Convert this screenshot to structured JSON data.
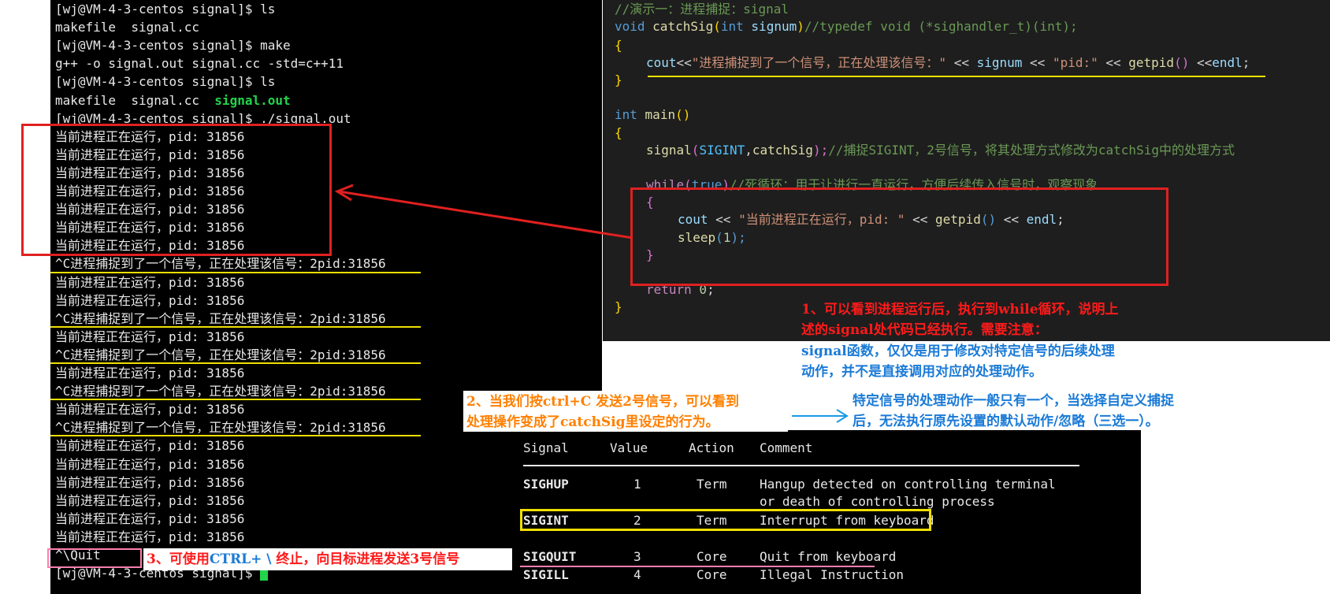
{
  "terminal": {
    "lines": [
      "[wj@VM-4-3-centos signal]$ ls",
      "makefile  signal.cc",
      "[wj@VM-4-3-centos signal]$ make",
      "g++ -o signal.out signal.cc -std=c++11",
      "[wj@VM-4-3-centos signal]$ ls",
      "makefile  signal.cc  ",
      "[wj@VM-4-3-centos signal]$ ./signal.out",
      "当前进程正在运行，pid: 31856",
      "当前进程正在运行，pid: 31856",
      "当前进程正在运行，pid: 31856",
      "当前进程正在运行，pid: 31856",
      "当前进程正在运行，pid: 31856",
      "当前进程正在运行，pid: 31856",
      "当前进程正在运行，pid: 31856",
      "^C进程捕捉到了一个信号，正在处理该信号：2pid:31856",
      "当前进程正在运行，pid: 31856",
      "当前进程正在运行，pid: 31856",
      "^C进程捕捉到了一个信号，正在处理该信号：2pid:31856",
      "当前进程正在运行，pid: 31856",
      "^C进程捕捉到了一个信号，正在处理该信号：2pid:31856",
      "当前进程正在运行，pid: 31856",
      "^C进程捕捉到了一个信号，正在处理该信号：2pid:31856",
      "当前进程正在运行，pid: 31856",
      "^C进程捕捉到了一个信号，正在处理该信号：2pid:31856",
      "当前进程正在运行，pid: 31856",
      "当前进程正在运行，pid: 31856",
      "当前进程正在运行，pid: 31856",
      "当前进程正在运行，pid: 31856",
      "当前进程正在运行，pid: 31856",
      "当前进程正在运行，pid: 31856",
      "^\\Quit",
      "[wj@VM-4-3-centos signal]$ "
    ],
    "binary_name": "signal.out",
    "prompt_color": "#22d54b"
  },
  "code": {
    "l1": "//演示一：进程捕捉：signal",
    "l2_kw": "void",
    "l2_fn": "catchSig",
    "l2_p1": "(",
    "l2_ty": "int",
    "l2_vr": "signum",
    "l2_p2": ")",
    "l2_cm": "//typedef void (*sighandler_t)(int);",
    "l3": "{",
    "l4_a": "cout",
    "l4_b": "<<",
    "l4_s1": "\"进程捕捉到了一个信号，正在处理该信号：\"",
    "l4_c": " << ",
    "l4_d": "signum",
    "l4_e": " << ",
    "l4_s2": "\"pid:\"",
    "l4_f": " << ",
    "l4_g": "getpid",
    "l4_h": "()",
    "l4_i": " <<",
    "l4_j": "endl",
    "l4_k": ";",
    "l5": "}",
    "l7_kw": "int",
    "l7_fn": "main",
    "l7_p": "()",
    "l8": "{",
    "l9_fn": "signal",
    "l9_p1": "(",
    "l9_mac": "SIGINT",
    "l9_c": ",",
    "l9_v": "catchSig",
    "l9_p2": ");",
    "l9_cm": "//捕捉SIGINT，2号信号，将其处理方式修改为catchSig中的处理方式",
    "l11_kw": "while",
    "l11_p1": "(",
    "l11_t": "true",
    "l11_p2": ")",
    "l11_cm": "//死循环：用于让进行一直运行，方便后续传入信号时，观察现象",
    "l12": "{",
    "l13_a": "cout",
    "l13_b": " << ",
    "l13_s": "\"当前进程正在运行，pid: \"",
    "l13_c": " << ",
    "l13_fn": "getpid",
    "l13_p": "()",
    "l13_d": " << ",
    "l13_e": "endl",
    "l13_f": ";",
    "l14_fn": "sleep",
    "l14_p1": "(",
    "l14_n": "1",
    "l14_p2": ");",
    "l15": "}",
    "l17_kw": "return",
    "l17_n": " 0",
    "l17_s": ";",
    "l18": "}"
  },
  "notes": {
    "n1_line1": "1、可以看到进程运行后，执行到while循环，说明上",
    "n1_line2": "述的signal处代码已经执行。需要注意：",
    "n1_line3": "signal函数，仅仅是用于修改对特定信号的后续处理",
    "n1_line4": "动作，并不是直接调用对应的处理动作。",
    "n1b_line1": "特定信号的处理动作一般只有一个，当选择自定义捕捉",
    "n1b_line2": "后，无法执行原先设置的默认动作/忽略（三选一）。",
    "n2_line1": "2、当我们按ctrl+C 发送2号信号，可以看到",
    "n2_line2": "处理操作变成了catchSig里设定的行为。",
    "n3_a": "3、可使用",
    "n3_b": "CTRL+ \\",
    "n3_c": " 终止，向目标进程发送3号信号"
  },
  "signal_table": {
    "headers": [
      "Signal",
      "Value",
      "Action",
      "Comment"
    ],
    "rows": [
      {
        "signal": "SIGHUP",
        "value": "1",
        "action": "Term",
        "comment": "Hangup detected on controlling terminal",
        "comment2": "or death of controlling process"
      },
      {
        "signal": "SIGINT",
        "value": "2",
        "action": "Term",
        "comment": "Interrupt from keyboard",
        "comment2": ""
      },
      {
        "signal": "SIGQUIT",
        "value": "3",
        "action": "Core",
        "comment": "Quit from keyboard",
        "comment2": ""
      },
      {
        "signal": "SIGILL",
        "value": "4",
        "action": "Core",
        "comment": "Illegal Instruction",
        "comment2": ""
      }
    ]
  },
  "colors": {
    "terminal_bg": "#000000",
    "editor_bg": "#1e1e1e",
    "highlight_red": "#e02020",
    "highlight_yellow": "#f0e000",
    "note_red": "#ff1a1a",
    "note_blue": "#1a7ad6",
    "note_orange": "#ff8000"
  }
}
